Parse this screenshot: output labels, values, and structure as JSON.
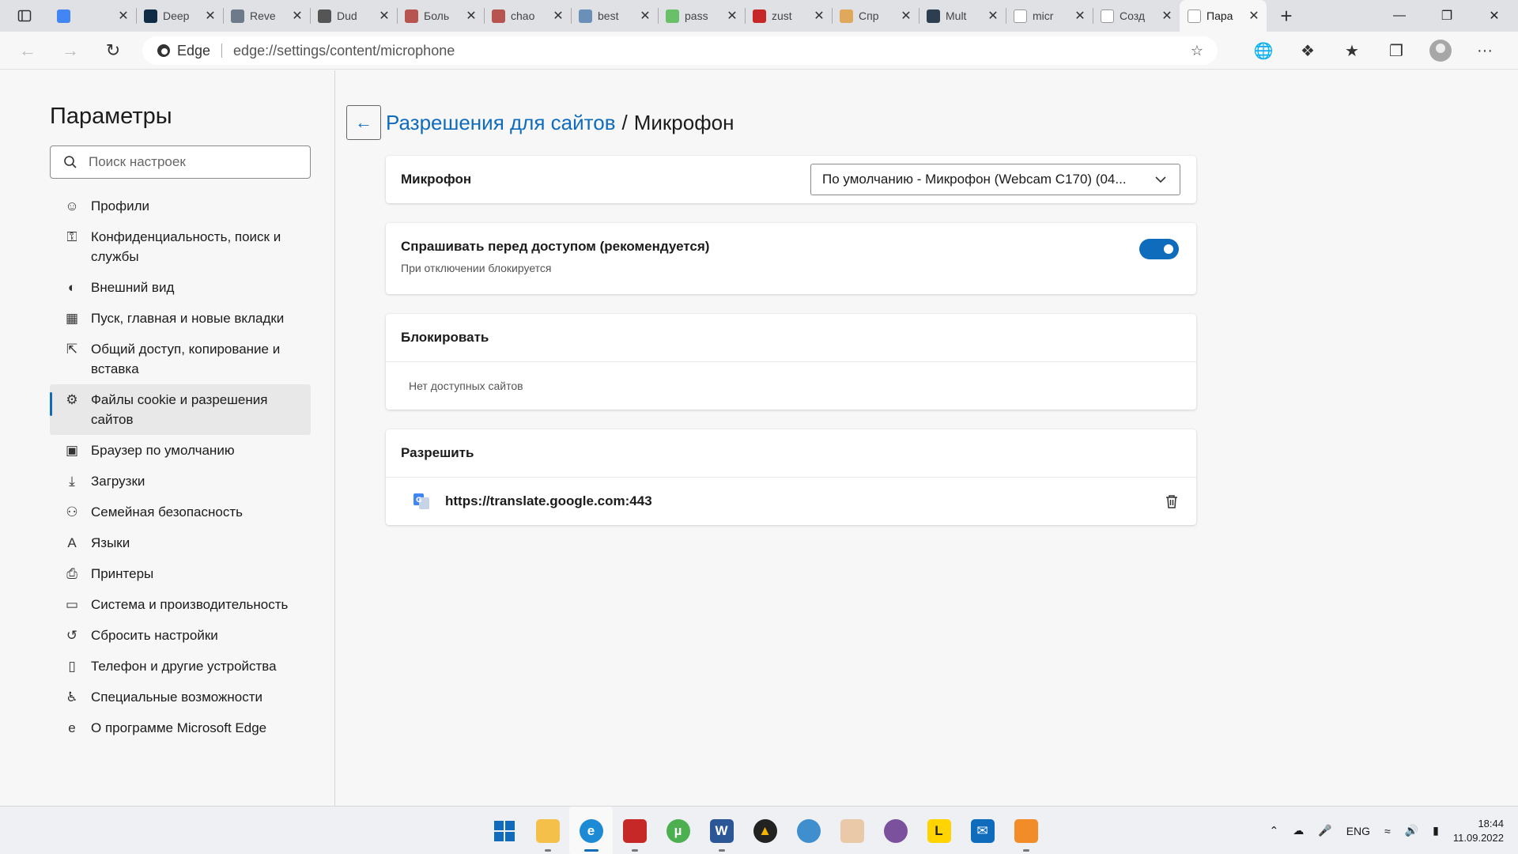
{
  "browser": {
    "tabs": [
      {
        "title": "",
        "favicon": "google-translate-icon",
        "color": "#4285f4"
      },
      {
        "title": "Deep",
        "favicon": "deepl-icon",
        "color": "#0f2b46"
      },
      {
        "title": "Reve",
        "favicon": "reverso-icon",
        "color": "#6d7a8a"
      },
      {
        "title": "Dud",
        "favicon": "dudu-icon",
        "color": "#555555"
      },
      {
        "title": "Боль",
        "favicon": "chart-icon",
        "color": "#b85450"
      },
      {
        "title": "chao",
        "favicon": "chart-icon",
        "color": "#b85450"
      },
      {
        "title": "best",
        "favicon": "feather-icon",
        "color": "#6a8fb8"
      },
      {
        "title": "pass",
        "favicon": "circle-icon",
        "color": "#6abf69"
      },
      {
        "title": "zust",
        "favicon": "dictionary-icon",
        "color": "#c62828"
      },
      {
        "title": "Спр",
        "favicon": "book-icon",
        "color": "#e0a85a"
      },
      {
        "title": "Mult",
        "favicon": "multitran-icon",
        "color": "#2c3e50"
      },
      {
        "title": "micr",
        "favicon": "google-icon",
        "color": "#ffffff"
      },
      {
        "title": "Созд",
        "favicon": "microsoft-icon",
        "color": "#ffffff"
      },
      {
        "title": "Пара",
        "favicon": "gear-icon",
        "color": "#ffffff",
        "active": true
      }
    ],
    "address": {
      "brand": "Edge",
      "url": "edge://settings/content/microphone"
    }
  },
  "sidebar": {
    "title": "Параметры",
    "search_placeholder": "Поиск настроек",
    "items": [
      {
        "label": "Профили"
      },
      {
        "label": "Конфиденциальность, поиск и службы"
      },
      {
        "label": "Внешний вид"
      },
      {
        "label": "Пуск, главная и новые вкладки"
      },
      {
        "label": "Общий доступ, копирование и вставка"
      },
      {
        "label": "Файлы cookie и разрешения сайтов",
        "active": true
      },
      {
        "label": "Браузер по умолчанию"
      },
      {
        "label": "Загрузки"
      },
      {
        "label": "Семейная безопасность"
      },
      {
        "label": "Языки"
      },
      {
        "label": "Принтеры"
      },
      {
        "label": "Система и производительность"
      },
      {
        "label": "Сбросить настройки"
      },
      {
        "label": "Телефон и другие устройства"
      },
      {
        "label": "Специальные возможности"
      },
      {
        "label": "О программе Microsoft Edge"
      }
    ]
  },
  "main": {
    "breadcrumb_link": "Разрешения для сайтов",
    "breadcrumb_sep": "/",
    "breadcrumb_current": "Микрофон",
    "mic_label": "Микрофон",
    "mic_device": "По умолчанию - Микрофон (Webcam C170) (04...",
    "ask_title": "Спрашивать перед доступом (рекомендуется)",
    "ask_subtitle": "При отключении блокируется",
    "ask_enabled": true,
    "block_title": "Блокировать",
    "block_empty": "Нет доступных сайтов",
    "allow_title": "Разрешить",
    "allow_sites": [
      "https://translate.google.com:443"
    ]
  },
  "taskbar": {
    "language": "ENG",
    "time": "18:44",
    "date": "11.09.2022"
  },
  "colors": {
    "accent": "#0f6cbd"
  }
}
